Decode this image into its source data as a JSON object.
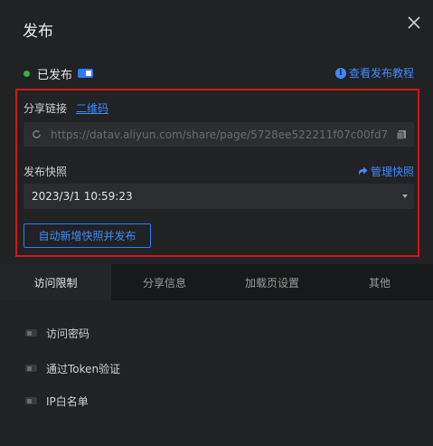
{
  "dialog": {
    "title": "发布",
    "close_icon": "close-icon"
  },
  "status": {
    "label": "已发布",
    "toggle_on": true,
    "dot_color": "#2fb344"
  },
  "help": {
    "icon": "info-icon",
    "icon_glyph": "i",
    "label": "查看发布教程"
  },
  "share": {
    "label": "分享链接",
    "qr_label": "二维码",
    "url": "https://datav.aliyun.com/share/page/5728ee522211f07c00fd7",
    "refresh_icon": "refresh-icon",
    "copy_icon": "copy-icon"
  },
  "snapshot": {
    "label": "发布快照",
    "manage_label": "管理快照",
    "manage_icon": "share-arrow-icon",
    "selected": "2023/3/1 10:59:23"
  },
  "auto_button": {
    "label": "自动新增快照并发布"
  },
  "tabs": [
    {
      "label": "访问限制",
      "active": true
    },
    {
      "label": "分享信息",
      "active": false
    },
    {
      "label": "加载页设置",
      "active": false
    },
    {
      "label": "其他",
      "active": false
    }
  ],
  "options": [
    {
      "label": "访问密码",
      "enabled": false
    },
    {
      "label": "通过Token验证",
      "enabled": false
    },
    {
      "label": "IP白名单",
      "enabled": false
    }
  ],
  "colors": {
    "accent": "#3d8bff",
    "highlight_border": "#d8141c",
    "background": "#212224"
  }
}
